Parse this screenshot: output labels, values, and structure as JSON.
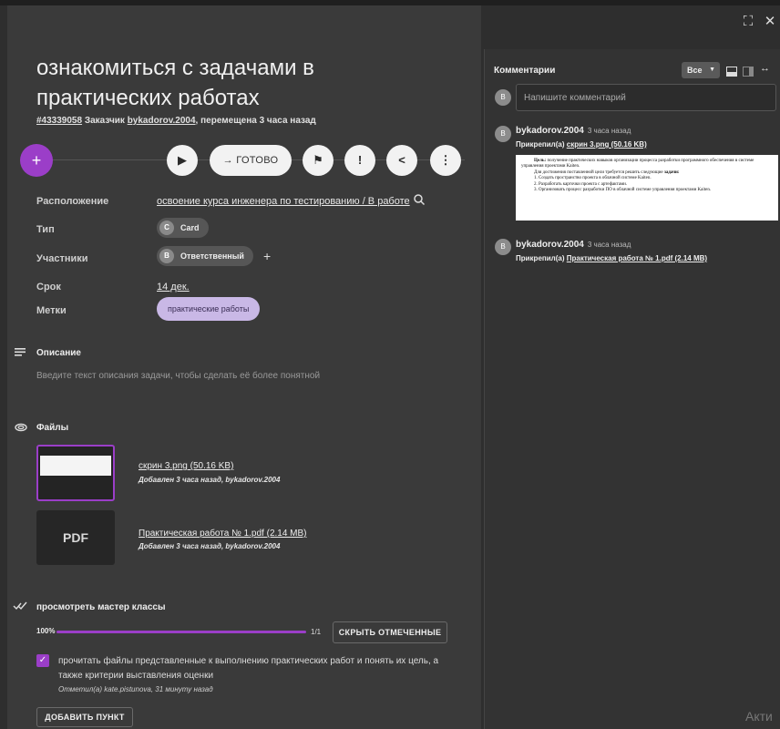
{
  "window": {
    "expand_icon": "⛶",
    "close_icon": "✕"
  },
  "card": {
    "title": "ознакомиться с задачами в практических работах",
    "id": "#43339058",
    "customer_prefix": "Заказчик",
    "customer": "bykadorov.2004",
    "moved": ", перемещена 3 часа назад"
  },
  "actions": {
    "add": "+",
    "play": "▶",
    "done_label": "→ ГОТОВО",
    "flag": "⚑",
    "alert": "!",
    "share": "<",
    "more": "⋮"
  },
  "props": {
    "location_label": "Расположение",
    "location_value": "освоение курса инженера по тестированию / В работе",
    "type_label": "Тип",
    "type_avatar": "C",
    "type_value": "Card",
    "members_label": "Участники",
    "member_avatar": "В",
    "member_value": "Ответственный",
    "add_member": "+",
    "due_label": "Срок",
    "due_value": "14 дек.",
    "tags_label": "Метки",
    "tag_value": "практические работы"
  },
  "description": {
    "heading": "Описание",
    "placeholder": "Введите текст описания задачи, чтобы сделать её более понятной"
  },
  "files": {
    "heading": "Файлы",
    "items": [
      {
        "name": "скрин 3.png (50.16 KB)",
        "meta_prefix": "Добавлен 3 часа назад, ",
        "meta_author": "bykadorov.2004"
      },
      {
        "name": "Практическая работа № 1.pdf (2.14 MB)",
        "meta_prefix": "Добавлен 3 часа назад, ",
        "meta_author": "bykadorov.2004",
        "thumb_label": "PDF"
      }
    ]
  },
  "checklist": {
    "title": "просмотреть мастер классы",
    "percent": "100%",
    "progress": 1.0,
    "count": "1/1",
    "hide_button": "СКРЫТЬ ОТМЕЧЕННЫЕ",
    "items": [
      {
        "text": "прочитать файлы представленные к выполнению практических работ и понять их цель, а также критерии выставления оценки",
        "meta": "Отметил(а) kate.pistunova, 31 минуту назад",
        "checked": true
      }
    ],
    "add_button": "ДОБАВИТЬ ПУНКТ"
  },
  "comments": {
    "title": "Комментарии",
    "filter": "Все",
    "input_placeholder": "Напишите комментарий",
    "user_avatar": "B",
    "items": [
      {
        "avatar": "B",
        "author": "bykadorov.2004",
        "time": "3 часа назад",
        "prefix": "Прикрепил(а)",
        "attachment": "скрин 3.png (50.16 KB)",
        "preview": {
          "goal_label": "Цель:",
          "goal_text": " получение практических навыков организации процесса разработки программного обеспечения в системе управления проектами Kaiten.",
          "tasks_intro": "Для достижения поставленной цели требуется решить следующие ",
          "tasks_label": "задачи:",
          "task1": "1. Создать пространство проекта в облачной системе Kaiten.",
          "task2": "2. Разработать карточки проекта с артефактами.",
          "task3": "3. Организовать процесс разработки ПО в облачной системе управления проектами Kaiten."
        }
      },
      {
        "avatar": "B",
        "author": "bykadorov.2004",
        "time": "3 часа назад",
        "prefix": "Прикрепил(а)",
        "attachment": "Практическая работа № 1.pdf (2.14 MB)"
      }
    ]
  },
  "watermark": "Акти"
}
